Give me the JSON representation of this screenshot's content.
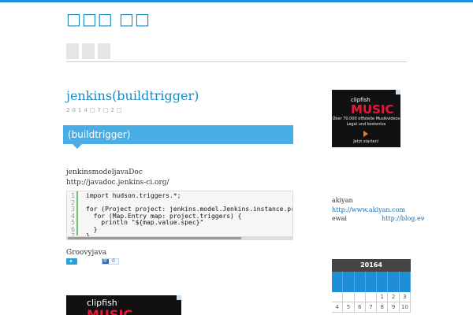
{
  "header": {
    "site_title": "□□□ □□",
    "nav": [
      "□",
      "□",
      "□"
    ]
  },
  "post": {
    "title": "jenkins(buildtrigger)",
    "date": "2014□7□2□",
    "section_heading": "(buildtrigger)",
    "intro": "jenkinsmodeljavaDoc",
    "link": "http://javadoc.jenkins-ci.org/",
    "code": {
      "line_numbers": [
        "1",
        "2",
        "3",
        "4",
        "5",
        "6",
        "7"
      ],
      "lines": [
        "import hudson.triggers.*;",
        "",
        "for (Project project: jenkins.model.Jenkins.instance.projec",
        "  for (Map.Entry map: project.triggers) {",
        "    println \"${map.value.spec}\"",
        "  }",
        "}"
      ]
    },
    "footer_text": "Groovyjava",
    "share": {
      "tweet_icon": "twitter-bird-icon",
      "hatena_label": "B!",
      "hatena_count": "0"
    }
  },
  "ad": {
    "brand": "clipfish",
    "product": "MUSIC",
    "line1": "Über 70.000 offizielle Musikvideos",
    "line2": "Legal und kostenlos",
    "cta": "Jetzt starten!"
  },
  "sidebar": {
    "profile_name": "akiyan",
    "profile_link": "http://www.akiyan.com",
    "profile2_name": "ewai",
    "profile2_link": "http://blog.ewa"
  },
  "calendar": {
    "title": "20164",
    "rows": [
      [
        "",
        "",
        "",
        "",
        "1",
        "2",
        "3"
      ],
      [
        "4",
        "5",
        "6",
        "7",
        "8",
        "9",
        "10"
      ]
    ]
  },
  "colors": {
    "accent": "#1e90d8",
    "heading_box": "#4aaee6",
    "ad_red": "#e8173a"
  }
}
